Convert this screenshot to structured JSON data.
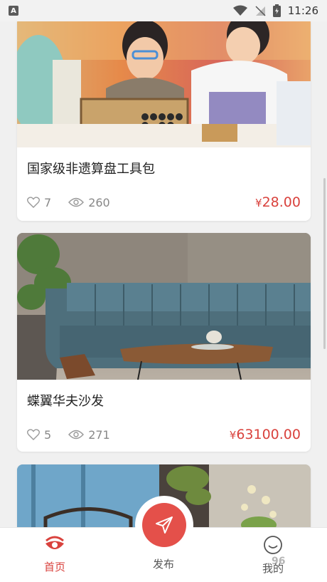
{
  "status_bar": {
    "badge": "A",
    "time": "11:26"
  },
  "products": [
    {
      "title": "国家级非遗算盘工具包",
      "likes": "7",
      "views": "260",
      "currency": "¥",
      "price": "28.00"
    },
    {
      "title": "蝶翼华夫沙发",
      "likes": "5",
      "views": "271",
      "currency": "¥",
      "price": "63100.00"
    }
  ],
  "tabs": [
    {
      "label": "首页",
      "active": true
    },
    {
      "label": "发布",
      "active": false
    },
    {
      "label": "我的",
      "active": false
    }
  ],
  "watermark": "96",
  "colors": {
    "accent": "#d9423d",
    "fab": "#e4504a",
    "background": "#f0f0f0"
  }
}
